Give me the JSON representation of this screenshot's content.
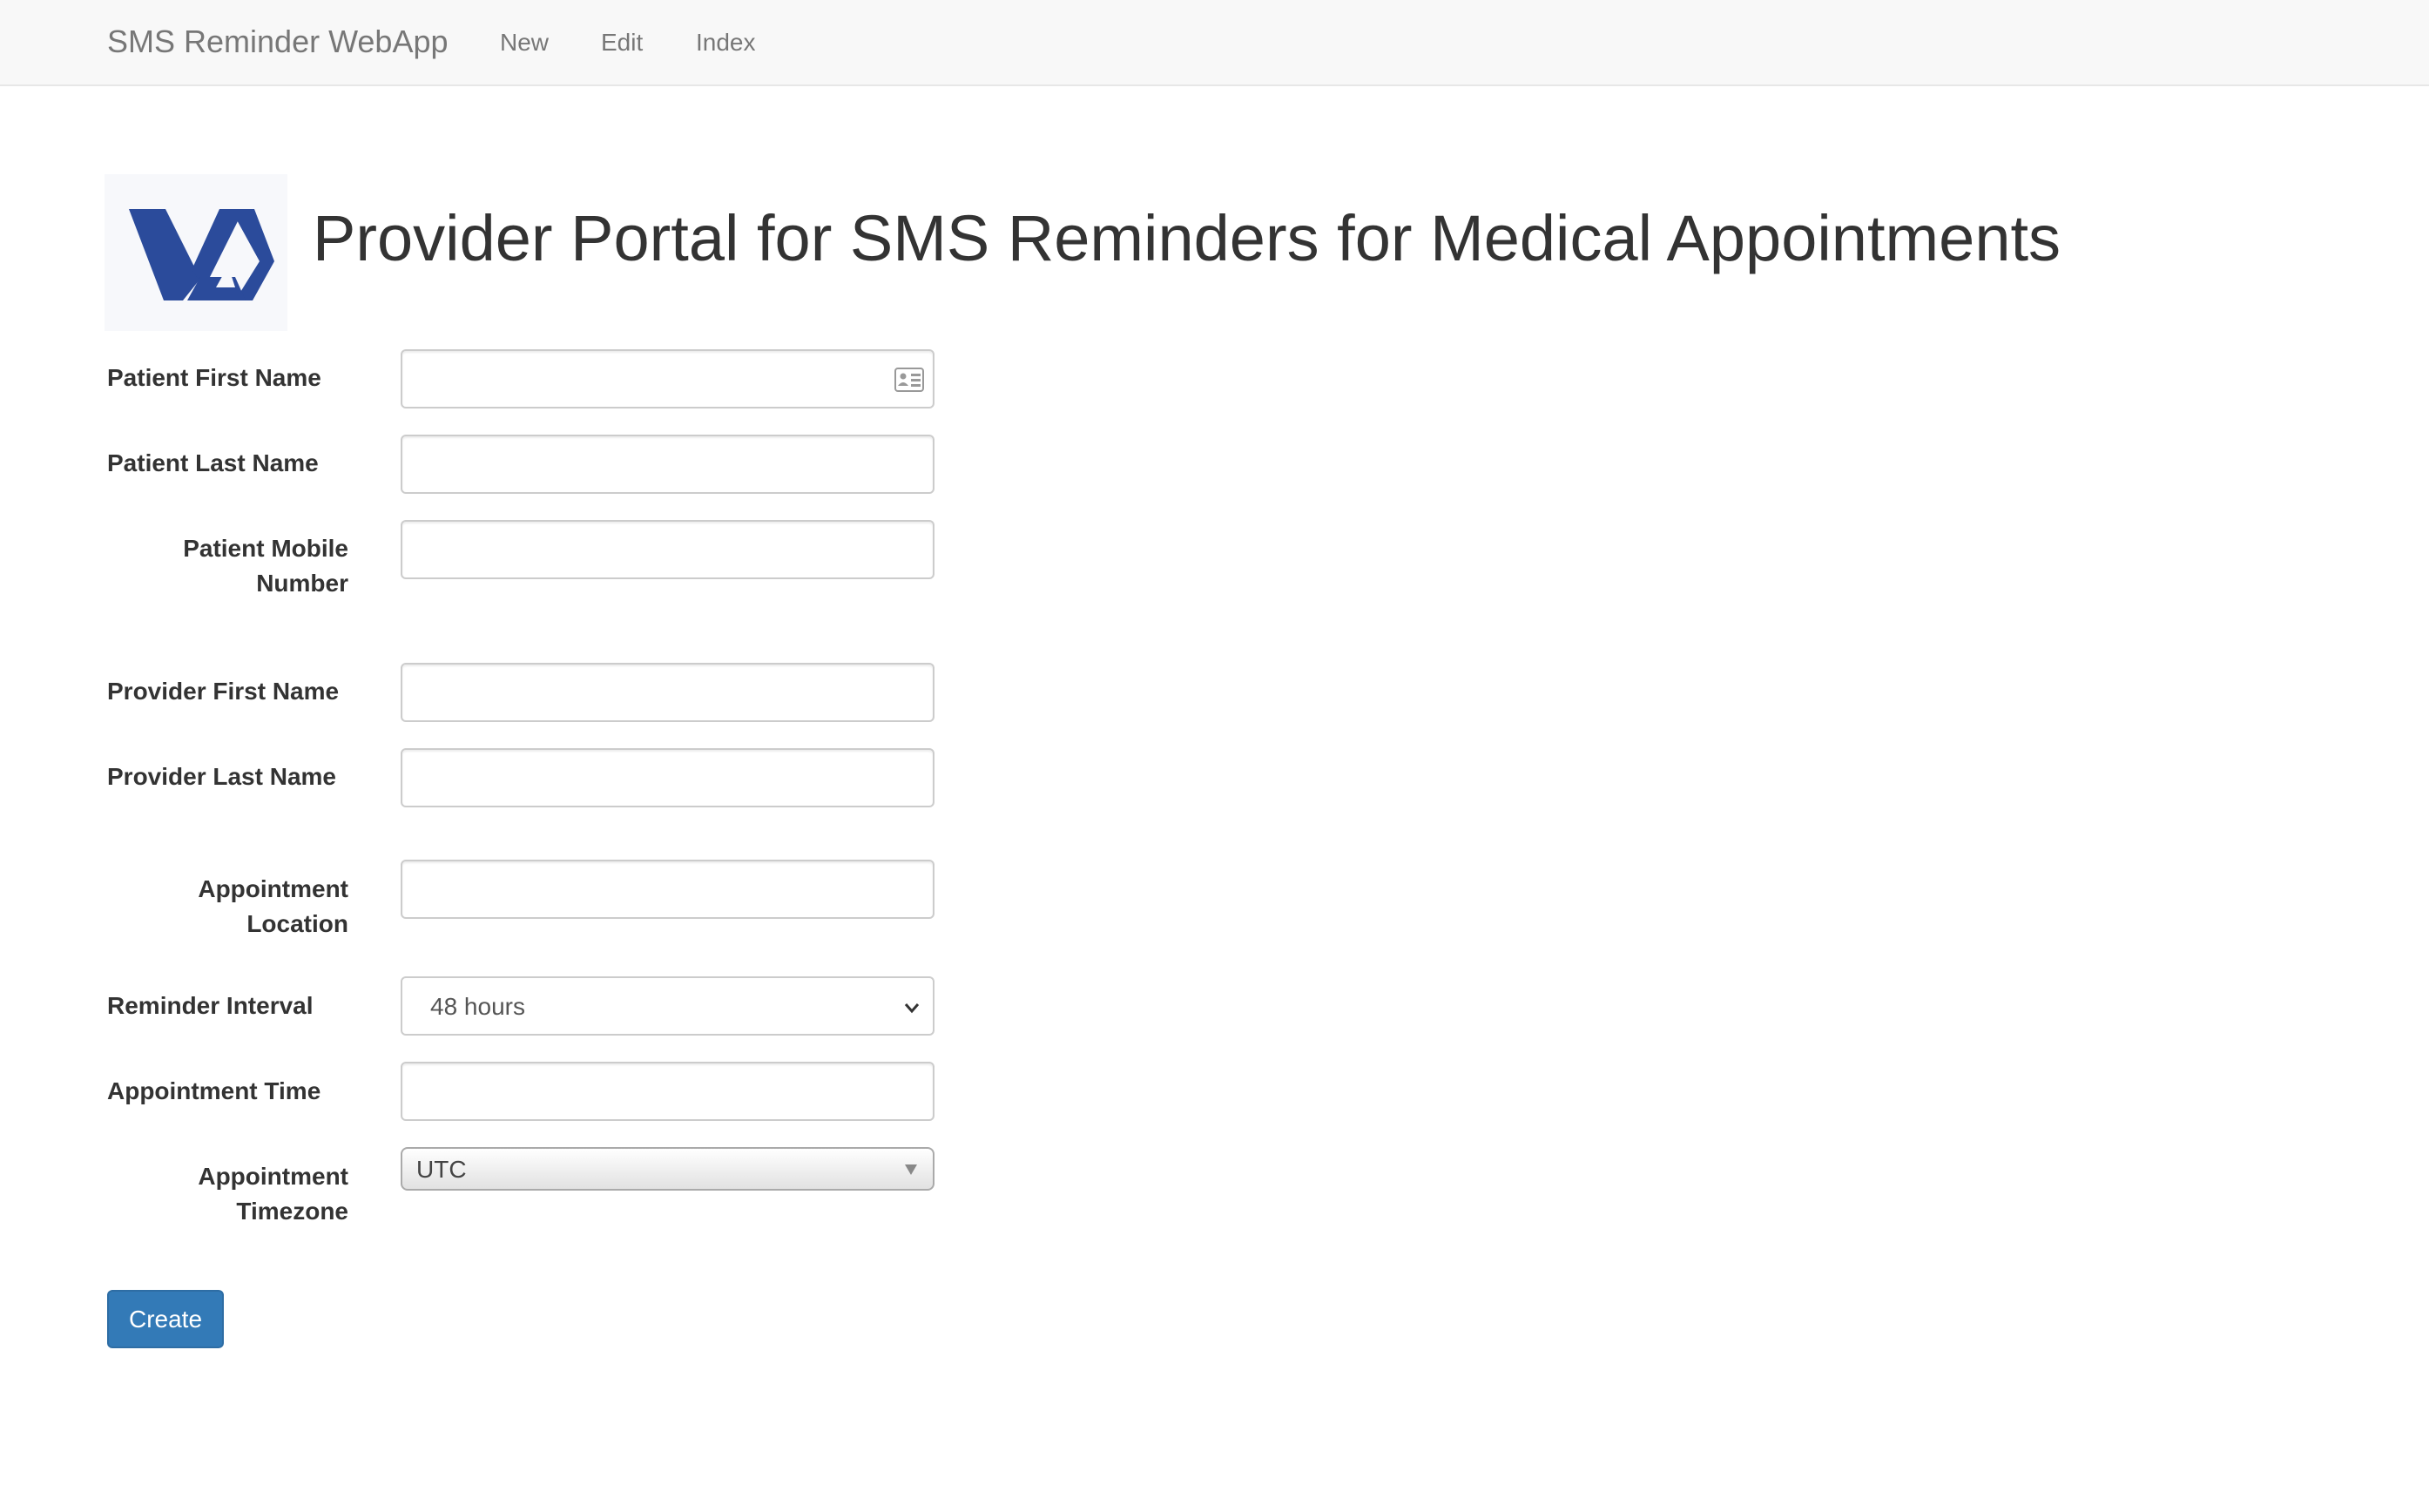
{
  "navbar": {
    "brand": "SMS Reminder WebApp",
    "links": [
      "New",
      "Edit",
      "Index"
    ]
  },
  "header": {
    "logo_icon": "va-logo-icon",
    "title": "Provider Portal for SMS Reminders for Medical Appointments"
  },
  "form": {
    "patient_first_name": {
      "label": "Patient First Name",
      "value": ""
    },
    "patient_last_name": {
      "label": "Patient Last Name",
      "value": ""
    },
    "patient_mobile_number": {
      "label": "Patient Mobile Number",
      "value": ""
    },
    "provider_first_name": {
      "label": "Provider First Name",
      "value": ""
    },
    "provider_last_name": {
      "label": "Provider Last Name",
      "value": ""
    },
    "appointment_location": {
      "label": "Appointment Location",
      "value": ""
    },
    "reminder_interval": {
      "label": "Reminder Interval",
      "selected": "48 hours"
    },
    "appointment_time": {
      "label": "Appointment Time",
      "value": ""
    },
    "appointment_timezone": {
      "label": "Appointment Timezone",
      "selected": "UTC"
    },
    "submit_label": "Create"
  },
  "colors": {
    "navbar_bg": "#f8f8f8",
    "primary_button": "#337ab7",
    "logo_blue": "#2b4b9b"
  }
}
